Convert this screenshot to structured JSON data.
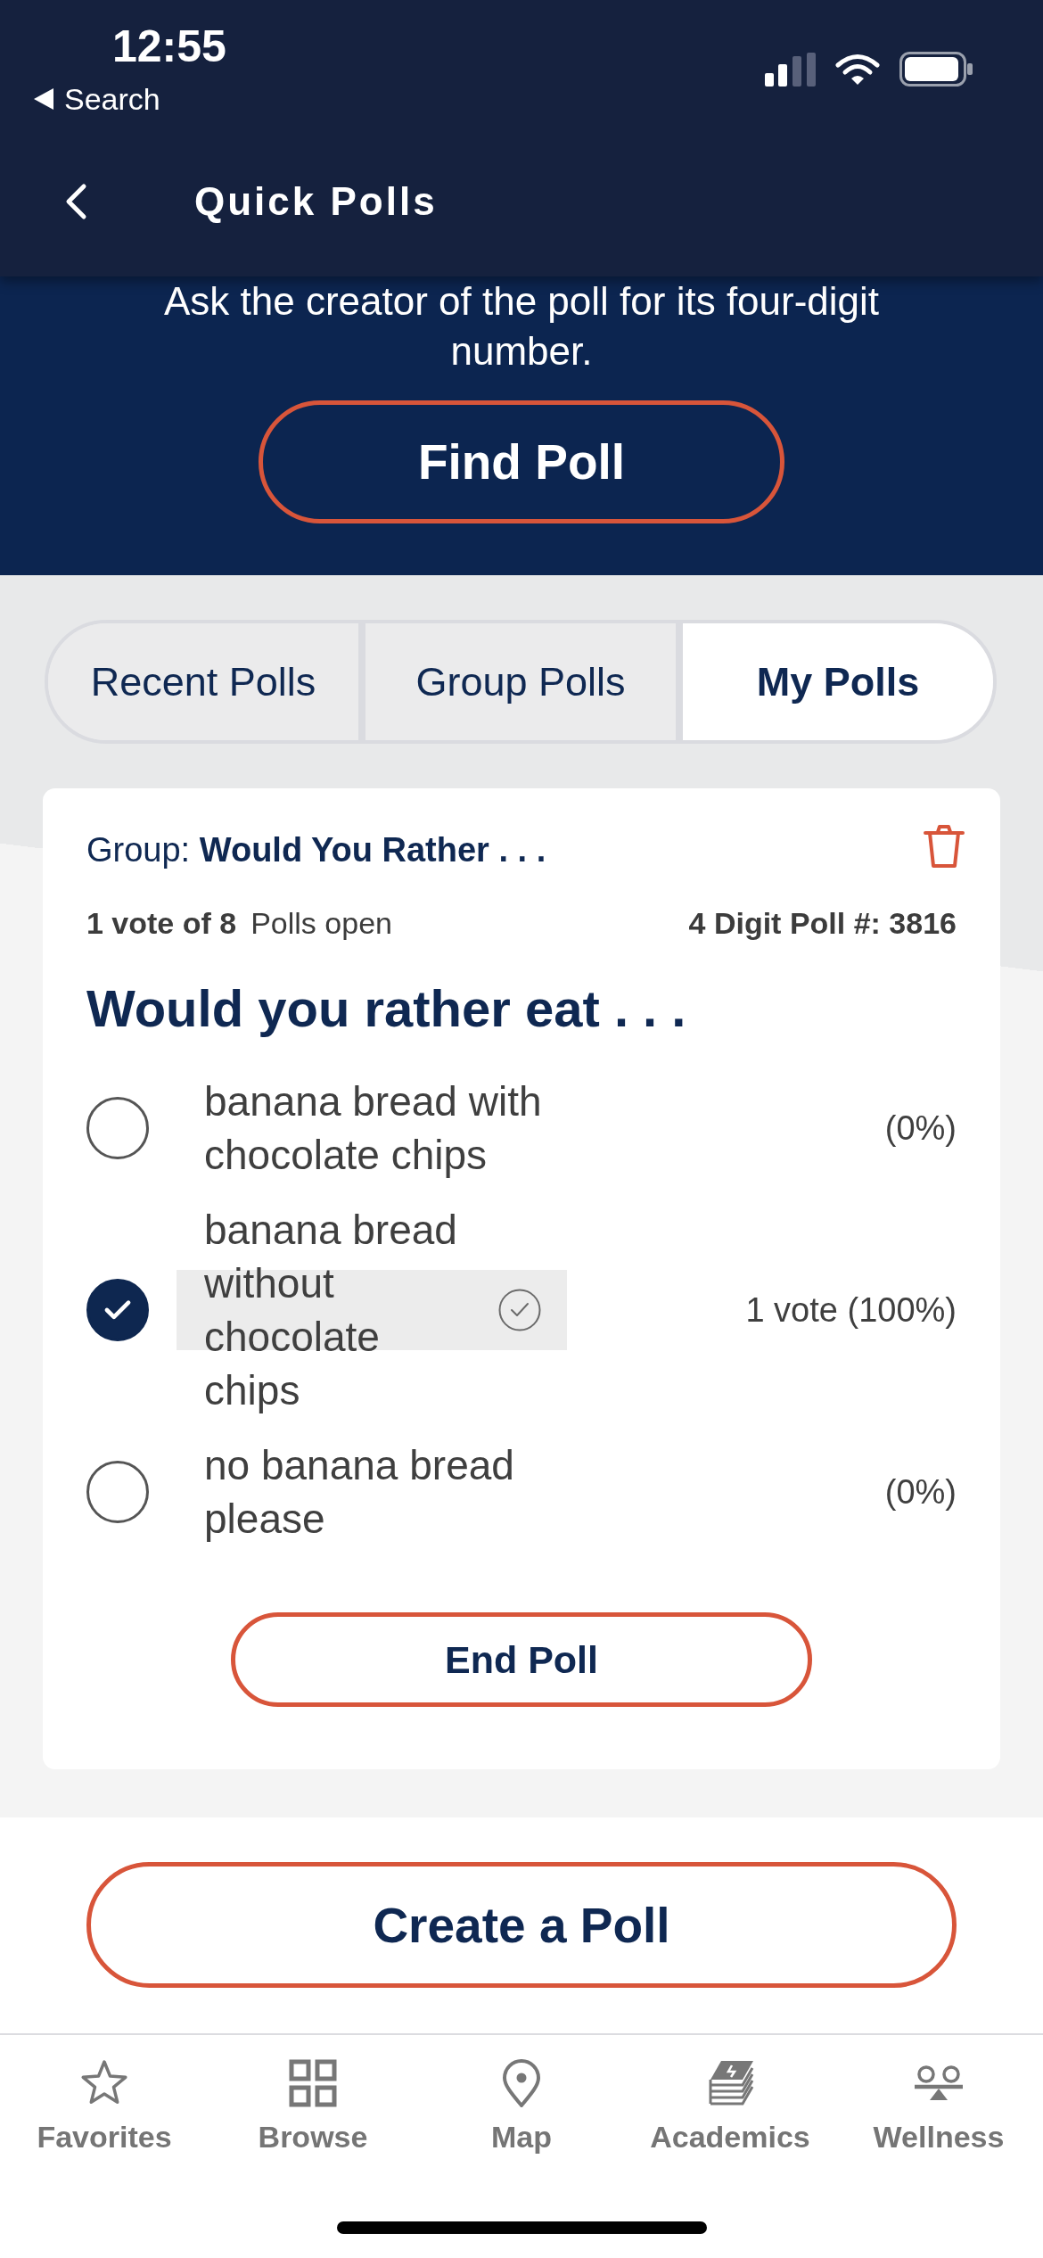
{
  "status_bar": {
    "time": "12:55",
    "back_label": "Search"
  },
  "header": {
    "title": "Quick Polls"
  },
  "find_poll": {
    "instruction": "Ask the creator of the poll for its four-digit number.",
    "button": "Find Poll"
  },
  "tabs": [
    {
      "label": "Recent Polls",
      "selected": false
    },
    {
      "label": "Group Polls",
      "selected": false
    },
    {
      "label": "My Polls",
      "selected": true
    }
  ],
  "poll": {
    "group": "Group: **Would You Rather . . .**",
    "votes": "1 vote of 8",
    "status": "Polls open",
    "number": "4 Digit Poll #: 3816",
    "question": "Would you rather eat . . .",
    "options": [
      {
        "text": "banana bread with chocolate chips",
        "result": "(0%)",
        "selected": false
      },
      {
        "text": "banana bread without chocolate chips",
        "result": "1 vote (100%)",
        "selected": true
      },
      {
        "text": "no banana bread please",
        "result": "(0%)",
        "selected": false
      }
    ],
    "end_button": "End Poll"
  },
  "create_button": "Create a Poll",
  "bottom_nav": [
    {
      "label": "Favorites"
    },
    {
      "label": "Browse"
    },
    {
      "label": "Map"
    },
    {
      "label": "Academics"
    },
    {
      "label": "Wellness"
    }
  ]
}
